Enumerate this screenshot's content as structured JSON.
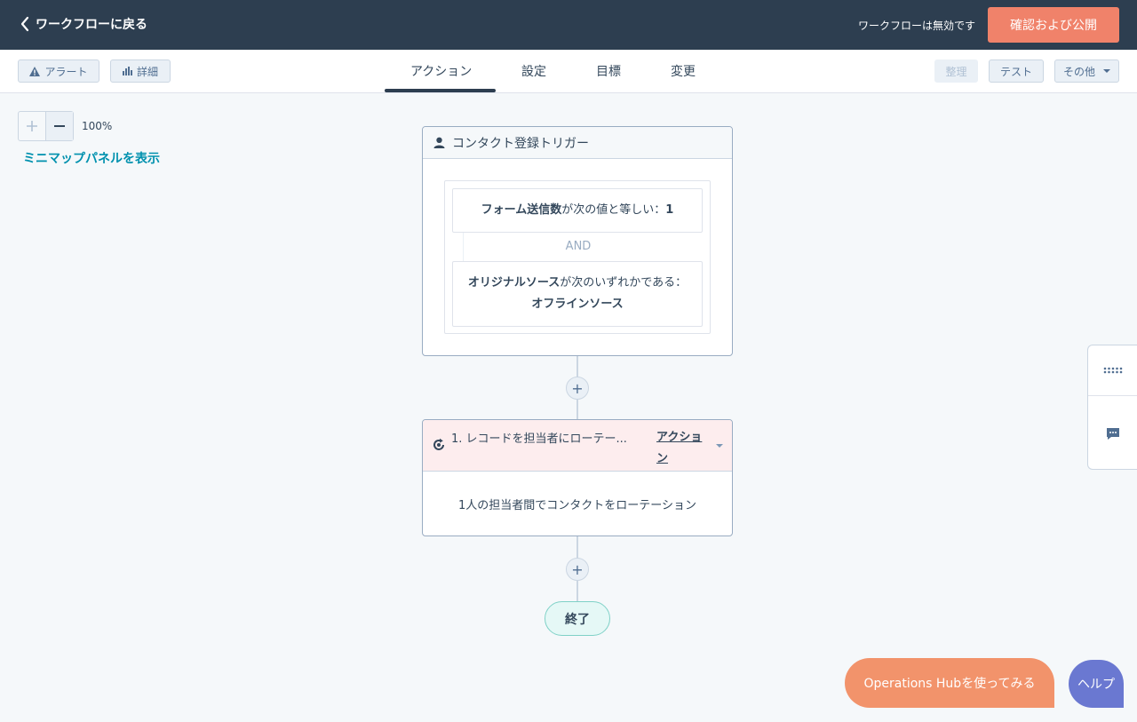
{
  "topbar": {
    "back_label": "ワークフローに戻る",
    "status": "ワークフローは無効です",
    "publish_label": "確認および公開"
  },
  "toolbar": {
    "alerts_label": "アラート",
    "details_label": "詳細",
    "tabs": [
      {
        "label": "アクション",
        "active": true
      },
      {
        "label": "設定",
        "active": false
      },
      {
        "label": "目標",
        "active": false
      },
      {
        "label": "変更",
        "active": false
      }
    ],
    "organize_label": "整理",
    "test_label": "テスト",
    "more_label": "その他"
  },
  "canvas": {
    "zoom_level": "100%",
    "minimap_link": "ミニマップパネルを表示"
  },
  "trigger": {
    "title": "コンタクト登録トリガー",
    "filter1": {
      "property": "フォーム送信数",
      "operator": "が次の値と等しい：",
      "value": "1"
    },
    "and_label": "AND",
    "filter2": {
      "property": "オリジナルソース",
      "operator": "が次のいずれかである：",
      "value": "オフラインソース"
    }
  },
  "action": {
    "title": "1. レコードを担当者にローテー...",
    "menu_label": "アクション",
    "body": "1人の担当者間でコンタクトをローテーション"
  },
  "end_label": "終了",
  "add_symbol": "+",
  "bottom": {
    "ops_label": "Operations Hubを使ってみる",
    "help_label": "ヘルプ"
  },
  "colors": {
    "topbar_bg": "#2d3e50",
    "publish_bg": "#f0826a",
    "link": "#0091ae",
    "action_head_bg": "#fdedee",
    "end_bg": "#e5f8f6",
    "ops_bg": "#f2936b",
    "help_bg": "#6a78d1"
  }
}
